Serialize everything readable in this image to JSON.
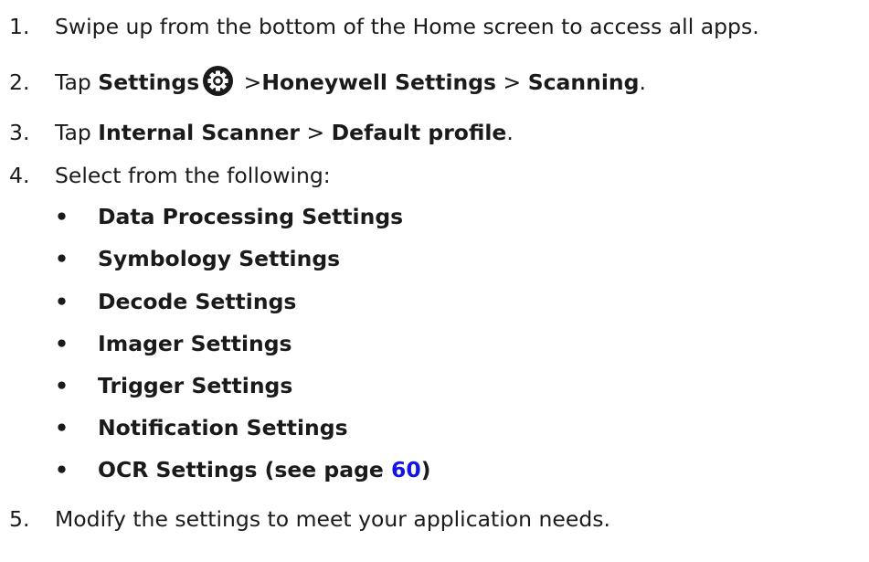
{
  "steps": [
    {
      "num": "1.",
      "text": "Swipe up from the bottom of the Home screen to access all apps."
    },
    {
      "num": "2.",
      "pre": "Tap ",
      "b1": "Settings",
      "icon": "settings-gear-icon",
      "sep1": " >",
      "b2": "Honeywell Settings",
      "sep2": " > ",
      "b3": "Scanning",
      "post": "."
    },
    {
      "num": "3.",
      "pre": "Tap ",
      "b1": "Internal Scanner",
      "sep1": " > ",
      "b2": "Default profile",
      "post": "."
    },
    {
      "num": "4.",
      "text": "Select from the following:"
    },
    {
      "num": "5.",
      "text": "Modify the settings to meet your application needs."
    }
  ],
  "bullet_char": "•",
  "options": [
    "Data Processing Settings",
    "Symbology Settings",
    "Decode Settings",
    "Imager Settings",
    "Trigger Settings",
    "Notification Settings"
  ],
  "ocr_option": {
    "pre": "OCR Settings (see page ",
    "link": "60",
    "post": ")"
  }
}
